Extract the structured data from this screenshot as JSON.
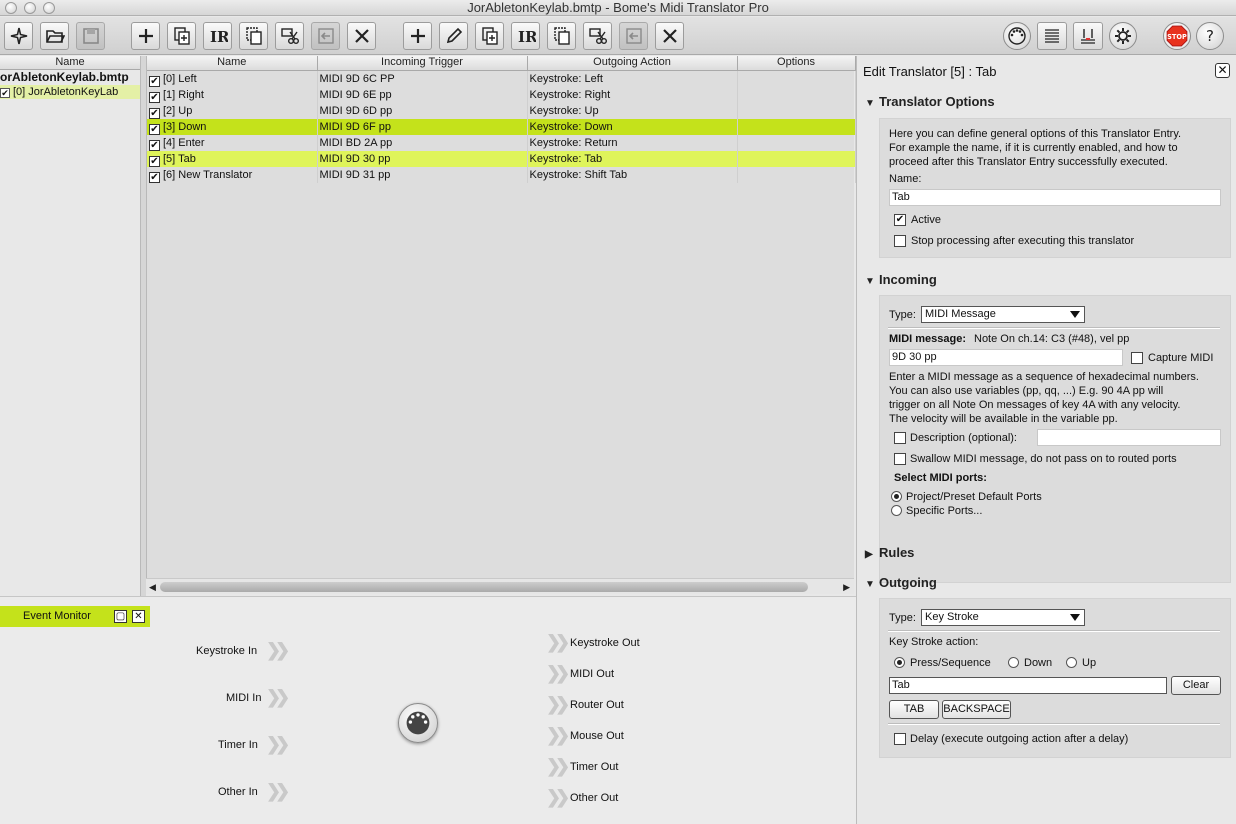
{
  "window": {
    "title": "JorAbletonKeylab.bmtp - Bome's Midi Translator Pro"
  },
  "project": {
    "col_header": "Name",
    "file_name": "orAbletonKeylab.bmtp",
    "presets": [
      {
        "label": "[0] JorAbletonKeyLab",
        "checked": true
      }
    ]
  },
  "table": {
    "headers": [
      "Name",
      "Incoming Trigger",
      "Outgoing Action",
      "Options"
    ],
    "rows": [
      {
        "name": "[0] Left",
        "trigger": "MIDI 9D 6C PP",
        "action": "Keystroke: Left",
        "checked": true
      },
      {
        "name": "[1] Right",
        "trigger": "MIDI 9D 6E pp",
        "action": "Keystroke: Right",
        "checked": true
      },
      {
        "name": "[2] Up",
        "trigger": "MIDI 9D 6D pp",
        "action": "Keystroke: Up",
        "checked": true
      },
      {
        "name": "[3] Down",
        "trigger": "MIDI 9D 6F pp",
        "action": "Keystroke: Down",
        "checked": true
      },
      {
        "name": "[4] Enter",
        "trigger": "MIDI BD 2A pp",
        "action": "Keystroke: Return",
        "checked": true
      },
      {
        "name": "[5] Tab",
        "trigger": "MIDI 9D 30 pp",
        "action": "Keystroke: Tab",
        "checked": true
      },
      {
        "name": "[6] New Translator",
        "trigger": "MIDI 9D 31 pp",
        "action": "Keystroke: Shift Tab",
        "checked": true
      }
    ]
  },
  "event_monitor": {
    "title": "Event Monitor",
    "inputs": [
      "Keystroke In",
      "MIDI In",
      "Timer In",
      "Other In"
    ],
    "outputs": [
      "Keystroke Out",
      "MIDI Out",
      "Router Out",
      "Mouse Out",
      "Timer Out",
      "Other Out"
    ]
  },
  "edit": {
    "title": "Edit Translator [5] : Tab",
    "translator_options": {
      "header": "Translator Options",
      "desc_lines": [
        "Here you can define general options of this Translator Entry.",
        "For example the name, if it is currently enabled, and how to",
        "proceed after this Translator Entry successfully executed."
      ],
      "name_label": "Name:",
      "name_value": "Tab",
      "active_label": "Active",
      "stop_label": "Stop processing after executing this translator"
    },
    "incoming": {
      "header": "Incoming",
      "type_label": "Type:",
      "type_value": "MIDI Message",
      "midi_msg_label": "MIDI message:",
      "midi_msg_desc": "Note On ch.14: C3 (#48), vel pp",
      "midi_value": "9D 30 pp",
      "capture_label": "Capture MIDI",
      "help_lines": [
        "Enter a MIDI message as a sequence of hexadecimal numbers.",
        "You can also use variables (pp, qq, ...) E.g. 90 4A pp will",
        "trigger on all Note On messages of key 4A with any velocity.",
        "The velocity will be available in the variable pp."
      ],
      "description_label": "Description (optional):",
      "swallow_label": "Swallow MIDI message, do not pass on to routed ports",
      "ports_label": "Select MIDI ports:",
      "port_opt1": "Project/Preset Default Ports",
      "port_opt2": "Specific Ports..."
    },
    "rules": {
      "header": "Rules"
    },
    "outgoing": {
      "header": "Outgoing",
      "type_label": "Type:",
      "type_value": "Key Stroke",
      "action_label": "Key Stroke action:",
      "opt_press": "Press/Sequence",
      "opt_down": "Down",
      "opt_up": "Up",
      "key_value": "Tab",
      "clear_label": "Clear",
      "tab_btn": "TAB",
      "backspace_btn": "BACKSPACE",
      "delay_label": "Delay (execute outgoing action after a delay)"
    }
  },
  "colors": {
    "highlight": "#c4e21b",
    "selected": "#dff45a",
    "stop": "#e8321e"
  }
}
